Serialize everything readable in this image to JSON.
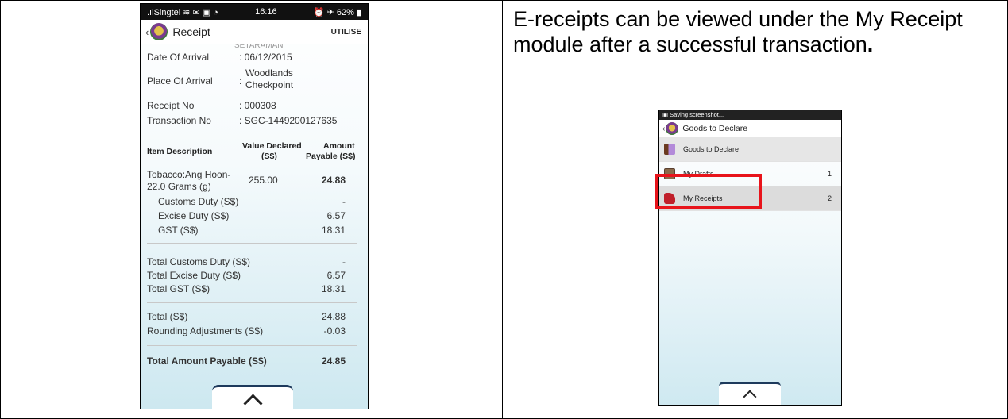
{
  "phone1": {
    "status": {
      "carrier": "Singtel",
      "time": "16:16",
      "battery": "62%"
    },
    "title": "Receipt",
    "action": "UTILISE",
    "cut_text": "SETARAMAN",
    "fields": [
      {
        "label": "Date Of Arrival",
        "value": ": 06/12/2015"
      },
      {
        "label": "Place Of Arrival",
        "value_line1": "Woodlands",
        "value_line2": "Checkpoint"
      },
      {
        "label": "Receipt No",
        "value": ": 000308"
      },
      {
        "label": "Transaction No",
        "value": ": SGC-1449200127635"
      }
    ],
    "table_headers": {
      "desc": "Item Description",
      "declared1": "Value Declared",
      "declared2": "(S$)",
      "amount1": "Amount",
      "amount2": "Payable (S$)"
    },
    "item": {
      "line1": "Tobacco:Ang Hoon-",
      "line2": "22.0 Grams (g)",
      "declared": "255.00",
      "amount": "24.88"
    },
    "duties": [
      {
        "label": "Customs Duty (S$)",
        "value": "-"
      },
      {
        "label": "Excise Duty (S$)",
        "value": "6.57"
      },
      {
        "label": "GST (S$)",
        "value": "18.31"
      }
    ],
    "totals": [
      {
        "label": "Total Customs Duty (S$)",
        "value": "-"
      },
      {
        "label": "Total Excise Duty (S$)",
        "value": "6.57"
      },
      {
        "label": "Total GST (S$)",
        "value": "18.31"
      }
    ],
    "sum": [
      {
        "label": "Total (S$)",
        "value": "24.88"
      },
      {
        "label": "Rounding Adjustments (S$)",
        "value": "-0.03"
      }
    ],
    "grand": {
      "label": "Total Amount Payable (S$)",
      "value": "24.85"
    }
  },
  "description": {
    "text": "E-receipts can be viewed under the My Receipt module after a successful transaction",
    "period": "."
  },
  "phone2": {
    "status": "Saving screenshot...",
    "title": "Goods to Declare",
    "menu": [
      {
        "label": "Goods to Declare",
        "count": ""
      },
      {
        "label": "My Drafts",
        "count": "1"
      },
      {
        "label": "My Receipts",
        "count": "2"
      }
    ]
  },
  "colors": {
    "highlight": "#e8141b",
    "tab_border": "#1e3a5c"
  }
}
